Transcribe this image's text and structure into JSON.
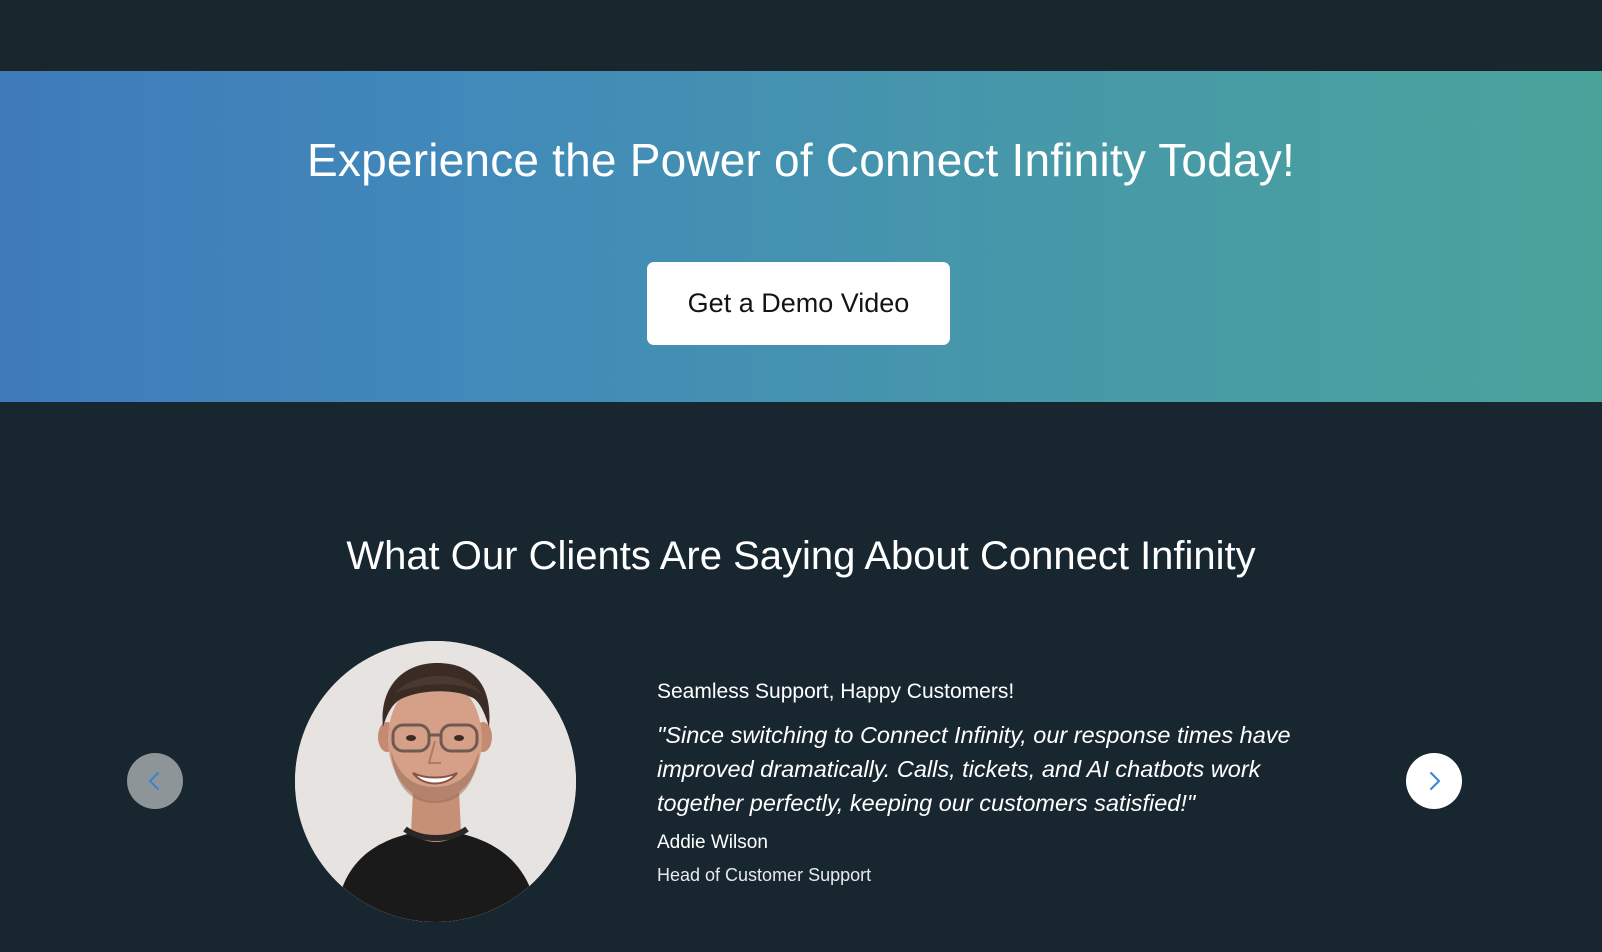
{
  "cta": {
    "title": "Experience the Power of Connect Infinity Today!",
    "button_label": "Get a Demo Video",
    "gradient_start": "#3f7abb",
    "gradient_end": "#4aa39b"
  },
  "testimonials": {
    "title": "What Our Clients Are Saying About Connect Infinity",
    "current": {
      "headline": "Seamless Support, Happy Customers!",
      "quote": "\"Since switching to Connect Infinity, our response times have improved dramatically. Calls, tickets, and AI chatbots work together perfectly, keeping our customers satisfied!\"",
      "author_name": "Addie Wilson",
      "author_role": "Head of Customer Support",
      "avatar_icon": "person-photo"
    },
    "prev_icon": "chevron-left-icon",
    "next_icon": "chevron-right-icon"
  },
  "colors": {
    "page_background": "#182630",
    "accent": "#3b82d6"
  }
}
